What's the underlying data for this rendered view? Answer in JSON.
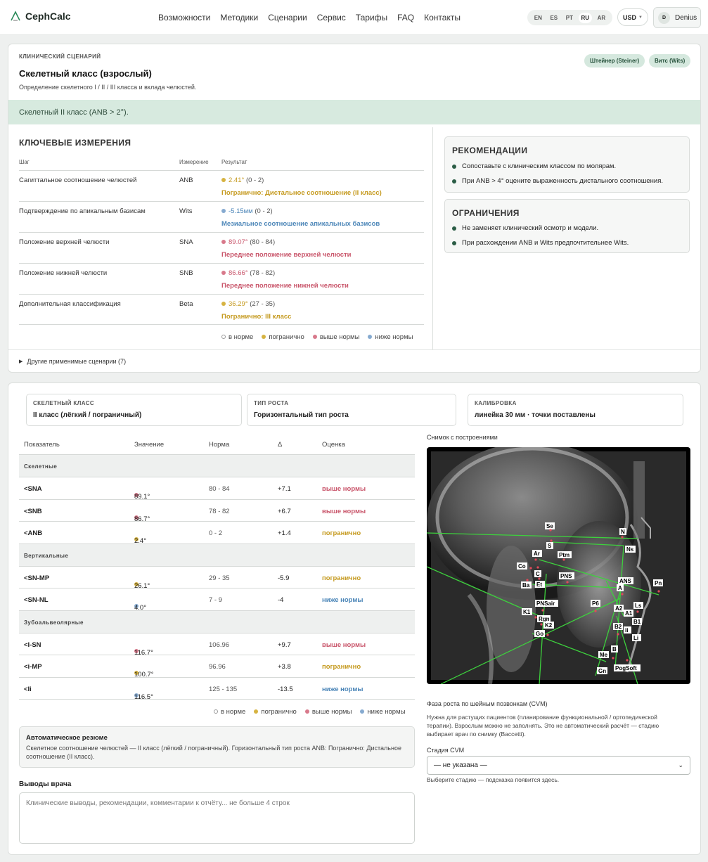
{
  "nav": {
    "logo": "CephCalc",
    "menu": [
      "Возможности",
      "Методики",
      "Сценарии",
      "Сервис",
      "Тарифы",
      "FAQ",
      "Контакты"
    ],
    "languages": [
      "EN",
      "ES",
      "PT",
      "RU",
      "AR"
    ],
    "active_language": "RU",
    "currency": "USD",
    "user_initial": "D",
    "user_name": "Denius"
  },
  "scenario": {
    "eyebrow": "Клинический сценарий",
    "title": "Скелетный класс (взрослый)",
    "subtitle": "Определение скелетного I / II / III класса и вклада челюстей.",
    "methods": [
      "Штейнер (Steiner)",
      "Витс (Wits)"
    ],
    "banner": "Скелетный II класс (ANB > 2°).",
    "key_title": "Ключевые измерения",
    "columns": {
      "step": "Шаг",
      "measure": "Измерение",
      "result": "Результат"
    },
    "rows": [
      {
        "step": "Сагиттальное соотношение челюстей",
        "measure": "ANB",
        "value": "2.41°",
        "norm": "(0 - 2)",
        "status": "yel",
        "verdict": "Погранично: Дистальное соотношение (II класс)"
      },
      {
        "step": "Подтверждение по апикальным базисам",
        "measure": "Wits",
        "value": "-5.15мм",
        "norm": "(0 - 2)",
        "status": "blu",
        "verdict": "Мезиальное соотношение апикальных базисов"
      },
      {
        "step": "Положение верхней челюсти",
        "measure": "SNA",
        "value": "89.07°",
        "norm": "(80 - 84)",
        "status": "red",
        "verdict": "Переднее положение верхней челюсти"
      },
      {
        "step": "Положение нижней челюсти",
        "measure": "SNB",
        "value": "86.66°",
        "norm": "(78 - 82)",
        "status": "red",
        "verdict": "Переднее положение нижней челюсти"
      },
      {
        "step": "Дополнительная классификация",
        "measure": "Beta",
        "value": "36.29°",
        "norm": "(27 - 35)",
        "status": "yel",
        "verdict": "Погранично: III класс"
      }
    ],
    "legend": [
      "в норме",
      "погранично",
      "выше нормы",
      "ниже нормы"
    ],
    "recommendations_title": "Рекомендации",
    "recommendations": [
      "Сопоставьте с клиническим классом по молярам.",
      "При ANB > 4° оцените выраженность дистального соотношения."
    ],
    "limits_title": "Ограничения",
    "limits": [
      "Не заменяет клинический осмотр и модели.",
      "При расхождении ANB и Wits предпочтительнее Wits."
    ],
    "other": "Другие применимые сценарии (7)"
  },
  "analysis": {
    "stats": [
      {
        "label": "Скелетный класс",
        "value": "II класс (лёгкий / пограничный)"
      },
      {
        "label": "Тип роста",
        "value": "Горизонтальный тип роста"
      },
      {
        "label": "Калибровка",
        "value": "линейка 30 мм · точки поставлены"
      }
    ],
    "columns": [
      "Показатель",
      "Значение",
      "Норма",
      "Δ",
      "Оценка"
    ],
    "groups": [
      {
        "name": "Скелетные",
        "rows": [
          {
            "name": "<SNA",
            "value": "89.1°",
            "norm": "80 - 84",
            "delta": "+7.1",
            "status": "red",
            "verdict": "выше нормы"
          },
          {
            "name": "<SNB",
            "value": "86.7°",
            "norm": "78 - 82",
            "delta": "+6.7",
            "status": "red",
            "verdict": "выше нормы"
          },
          {
            "name": "<ANB",
            "value": "2.4°",
            "norm": "0 - 2",
            "delta": "+1.4",
            "status": "yel",
            "verdict": "погранично"
          }
        ]
      },
      {
        "name": "Вертикальные",
        "rows": [
          {
            "name": "<SN-MP",
            "value": "26.1°",
            "norm": "29 - 35",
            "delta": "-5.9",
            "status": "yel",
            "verdict": "погранично"
          },
          {
            "name": "<SN-NL",
            "value": "4.0°",
            "norm": "7 - 9",
            "delta": "-4",
            "status": "blu",
            "verdict": "ниже нормы"
          }
        ]
      },
      {
        "name": "Зубоальвеолярные",
        "rows": [
          {
            "name": "<I-SN",
            "value": "116.7°",
            "norm": "106.96",
            "delta": "+9.7",
            "status": "red",
            "verdict": "выше нормы"
          },
          {
            "name": "<i-MP",
            "value": "100.7°",
            "norm": "96.96",
            "delta": "+3.8",
            "status": "yel",
            "verdict": "погранично"
          },
          {
            "name": "<Ii",
            "value": "116.5°",
            "norm": "125 - 135",
            "delta": "-13.5",
            "status": "blu",
            "verdict": "ниже нормы"
          }
        ]
      }
    ],
    "legend": [
      "в норме",
      "погранично",
      "выше нормы",
      "ниже нормы"
    ],
    "auto_title": "Автоматическое резюме",
    "auto_text": "Скелетное соотношение челюстей — II класс (лёгкий / пограничный). Горизонтальный тип роста ANB: Погранично: Дистальное соотношение (II класс).",
    "doctor_title": "Выводы врача",
    "doctor_placeholder": "Клинические выводы, рекомендации, комментарии к отчёту... не больше 4 строк",
    "image_label": "Снимок с построениями",
    "landmarks": [
      "Se",
      "S",
      "N",
      "Ns",
      "Ar",
      "Ptm",
      "Co",
      "C",
      "PNS",
      "ANS",
      "A",
      "Pn",
      "Ba",
      "Et",
      "PNSair",
      "P6",
      "A2",
      "Ls",
      "A1",
      "K1",
      "Rgn",
      "B1",
      "K2",
      "B2",
      "ii",
      "Go",
      "Li",
      "B",
      "Me",
      "PogSoft",
      "Gn"
    ],
    "cvm_title": "Фаза роста по шейным позвонкам (CVM)",
    "cvm_desc": "Нужна для растущих пациентов (планирование функциональной / ортопедической терапии). Взрослым можно не заполнять. Это не автоматический расчёт — стадию выбирает врач по снимку (Baccetti).",
    "cvm_label": "Стадия CVM",
    "cvm_value": "— не указана —",
    "cvm_hint": "Выберите стадию — подсказка появится здесь."
  },
  "colors": {
    "accent": "#2b5d46",
    "border": "#c59a1f",
    "above": "#c9566b",
    "below": "#4c86b8"
  }
}
